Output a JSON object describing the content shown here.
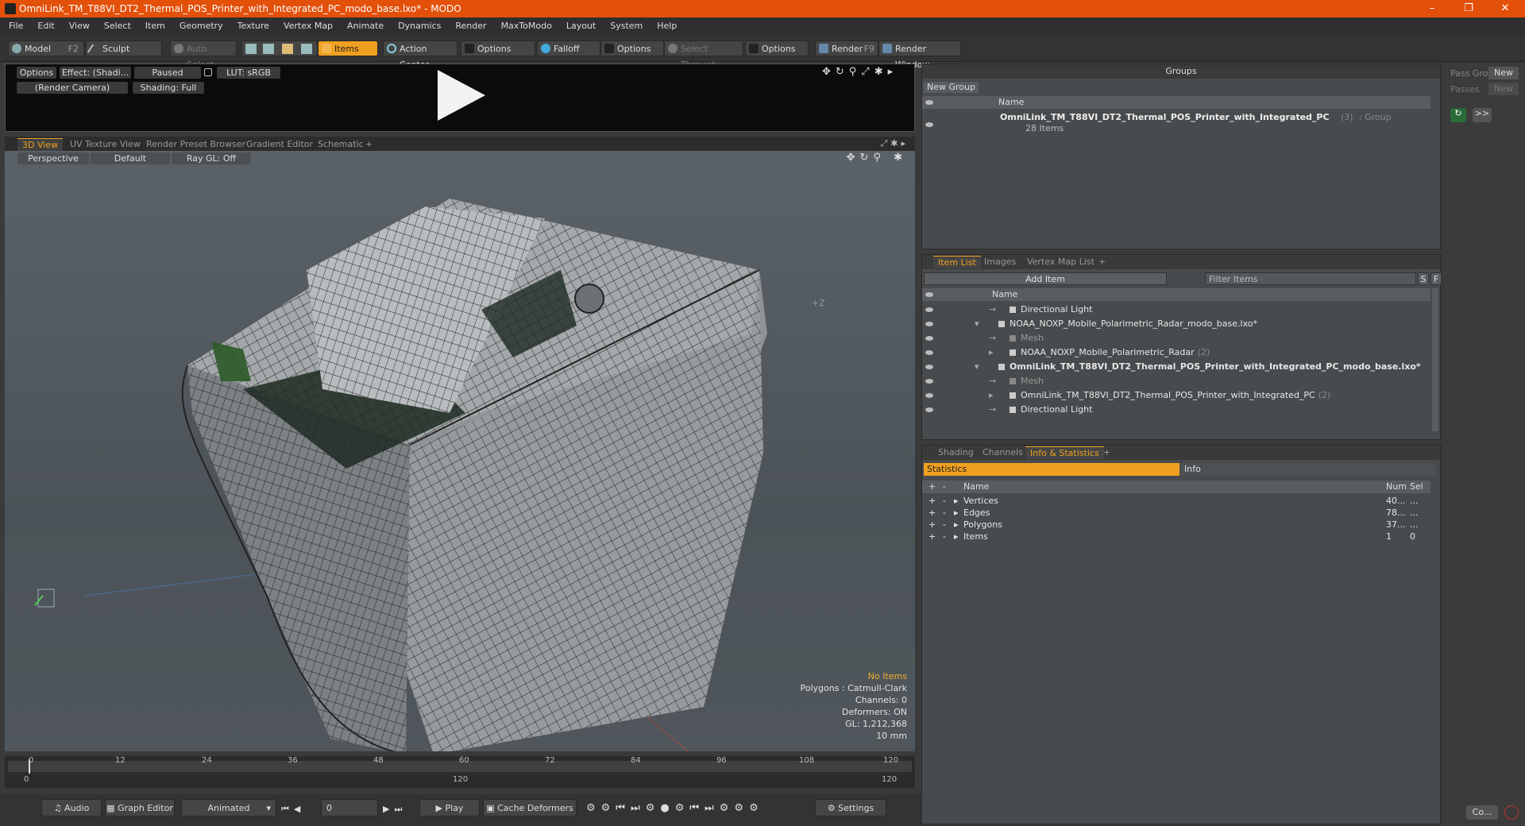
{
  "title": "OmniLink_TM_T88VI_DT2_Thermal_POS_Printer_with_Integrated_PC_modo_base.lxo* - MODO",
  "window_controls": {
    "minimize": "–",
    "restore": "❐",
    "close": "✕"
  },
  "menu": [
    "File",
    "Edit",
    "View",
    "Select",
    "Item",
    "Geometry",
    "Texture",
    "Vertex Map",
    "Animate",
    "Dynamics",
    "Render",
    "MaxToModo",
    "Layout",
    "System",
    "Help"
  ],
  "toolbar": {
    "model": "Model",
    "model_key": "F2",
    "sculpt": "Sculpt",
    "auto_select": "Auto Select",
    "items": "Items",
    "action_center": "Action Center",
    "options1": "Options",
    "falloff": "Falloff",
    "options2": "Options",
    "select_through": "Select Through",
    "options3": "Options",
    "render": "Render",
    "render_key": "F9",
    "render_window": "Render Window"
  },
  "preview": {
    "options": "Options",
    "effect": "Effect: (Shadi...",
    "paused": "Paused",
    "lut": "LUT: sRGB",
    "camera": "(Render Camera)",
    "shading": "Shading: Full"
  },
  "viewport_tabs": [
    "3D View",
    "UV Texture View",
    "Render Preset Browser",
    "Gradient Editor",
    "Schematic",
    "+"
  ],
  "viewport": {
    "perspective": "Perspective",
    "default": "Default",
    "raygl": "Ray GL: Off",
    "axis_label": "+Z",
    "info": {
      "no_items": "No Items",
      "polygons": "Polygons : Catmull-Clark",
      "channels": "Channels: 0",
      "deformers": "Deformers: ON",
      "gl": "GL: 1,212,368",
      "size": "10 mm"
    }
  },
  "timeline": {
    "ticks": [
      "0",
      "12",
      "24",
      "36",
      "48",
      "60",
      "72",
      "84",
      "96",
      "108",
      "120"
    ],
    "lower": [
      "0",
      "120",
      "120"
    ]
  },
  "transport": {
    "audio": "Audio",
    "graph_editor": "Graph Editor",
    "animated": "Animated",
    "frame": "0",
    "play": "Play",
    "cache": "Cache Deformers",
    "settings": "Settings"
  },
  "groups": {
    "title": "Groups",
    "new_group": "New Group",
    "col_name": "Name",
    "group_name": "OmniLink_TM_T88VI_DT2_Thermal_POS_Printer_with_Integrated_PC",
    "group_count": "(3)",
    "group_type": ": Group",
    "group_items": "28 Items"
  },
  "right_strip": {
    "pass_gro": "Pass Gro",
    "new1": "New",
    "passes": "Passes",
    "new2": "New",
    "arrows": ">>",
    "co": "Co..."
  },
  "item_list": {
    "tabs": [
      "Item List",
      "Images",
      "Vertex Map List",
      "+"
    ],
    "add_item": "Add Item",
    "filter": "Filter Items",
    "s": "S",
    "f": "F",
    "col_name": "Name",
    "rows": [
      {
        "label": "Directional Light",
        "indent": 1,
        "bold": false,
        "dim": false,
        "count": ""
      },
      {
        "label": "NOAA_NOXP_Mobile_Polarimetric_Radar_modo_base.lxo*",
        "indent": 0,
        "bold": false,
        "dim": false,
        "count": ""
      },
      {
        "label": "Mesh",
        "indent": 1,
        "bold": false,
        "dim": true,
        "count": ""
      },
      {
        "label": "NOAA_NOXP_Mobile_Polarimetric_Radar",
        "indent": 1,
        "bold": false,
        "dim": false,
        "count": "(2)"
      },
      {
        "label": "OmniLink_TM_T88VI_DT2_Thermal_POS_Printer_with_Integrated_PC_modo_base.lxo*",
        "indent": 0,
        "bold": true,
        "dim": false,
        "count": ""
      },
      {
        "label": "Mesh",
        "indent": 1,
        "bold": false,
        "dim": true,
        "count": ""
      },
      {
        "label": "OmniLink_TM_T88VI_DT2_Thermal_POS_Printer_with_Integrated_PC",
        "indent": 1,
        "bold": false,
        "dim": false,
        "count": "(2)"
      },
      {
        "label": "Directional Light",
        "indent": 1,
        "bold": false,
        "dim": false,
        "count": ""
      }
    ]
  },
  "stats": {
    "tabs": [
      "Shading",
      "Channels",
      "Info & Statistics",
      "+"
    ],
    "subtab_statistics": "Statistics",
    "subtab_info": "Info",
    "col_name": "Name",
    "col_num": "Num",
    "col_sel": "Sel",
    "rows": [
      {
        "name": "Vertices",
        "num": "40...",
        "sel": "..."
      },
      {
        "name": "Edges",
        "num": "78...",
        "sel": "..."
      },
      {
        "name": "Polygons",
        "num": "37...",
        "sel": "..."
      },
      {
        "name": "Items",
        "num": "1",
        "sel": "0"
      }
    ]
  }
}
